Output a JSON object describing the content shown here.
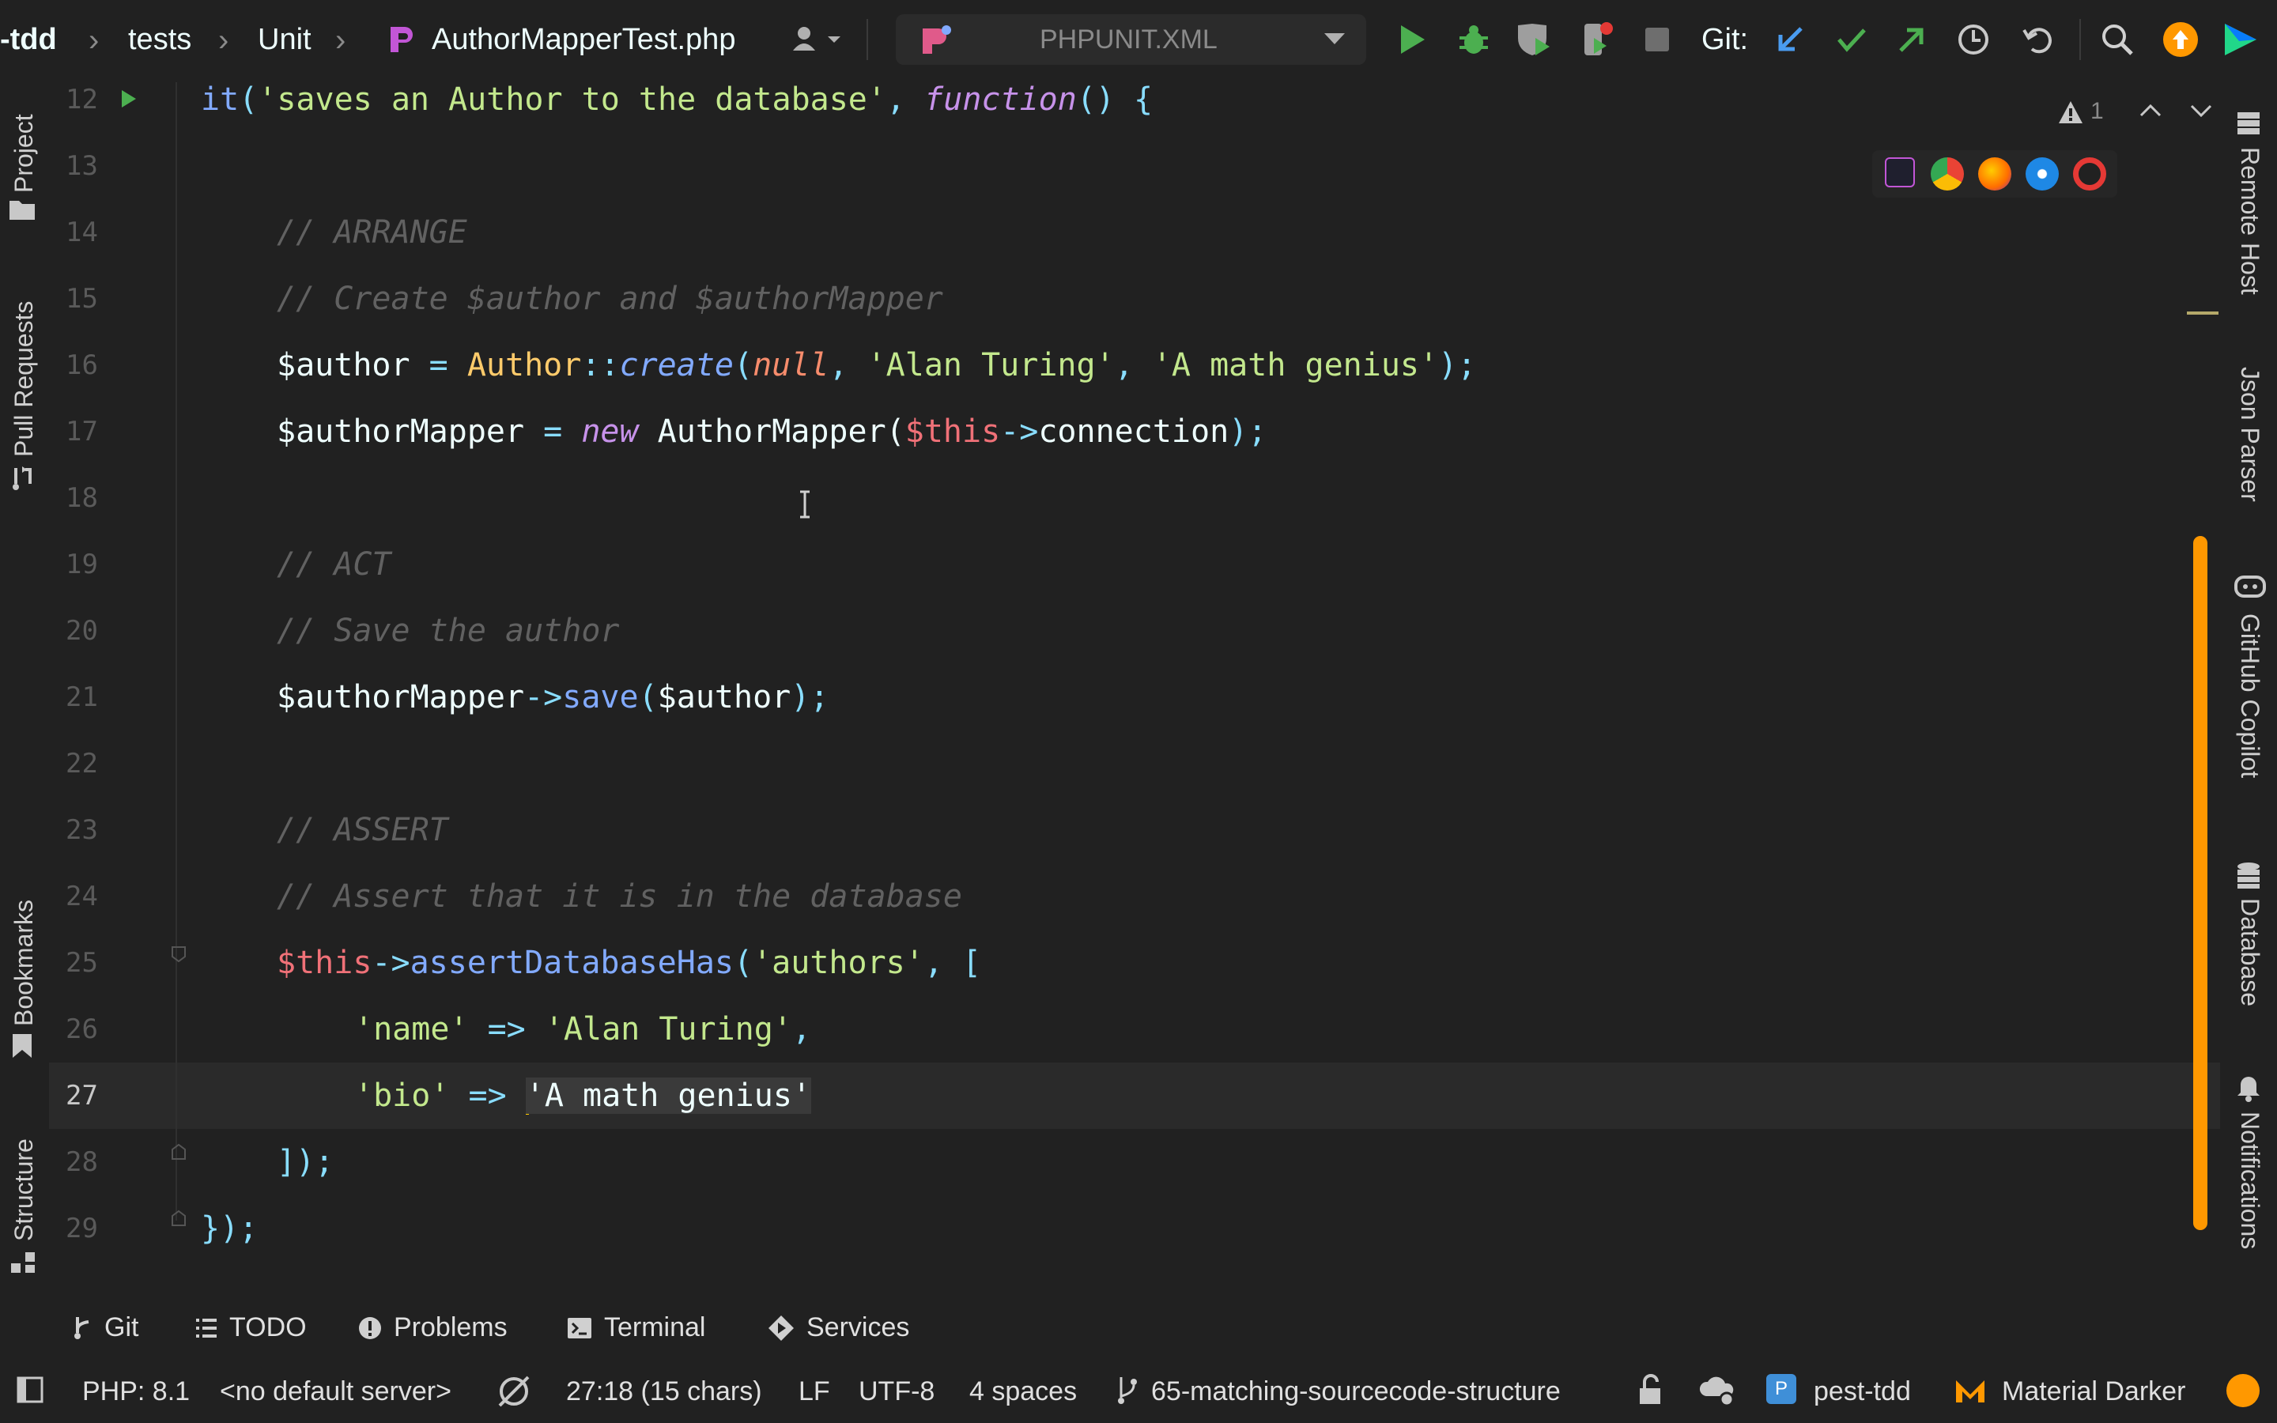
{
  "breadcrumb": {
    "project": "-tdd",
    "folder1": "tests",
    "folder2": "Unit",
    "file": "AuthorMapperTest.php"
  },
  "run_config": {
    "label": "PHPUNIT.XML"
  },
  "git_label": "Git:",
  "inspection": {
    "warning_count": "1"
  },
  "left_tools": [
    "Project",
    "Pull Requests",
    "Bookmarks",
    "Structure"
  ],
  "right_tools": [
    "Remote Host",
    "Json Parser",
    "GitHub Copilot",
    "Database",
    "Notifications"
  ],
  "editor": {
    "current_line": 27,
    "lines": [
      {
        "n": "12"
      },
      {
        "n": "13"
      },
      {
        "n": "14"
      },
      {
        "n": "15"
      },
      {
        "n": "16"
      },
      {
        "n": "17"
      },
      {
        "n": "18"
      },
      {
        "n": "19"
      },
      {
        "n": "20"
      },
      {
        "n": "21"
      },
      {
        "n": "22"
      },
      {
        "n": "23"
      },
      {
        "n": "24"
      },
      {
        "n": "25"
      },
      {
        "n": "26"
      },
      {
        "n": "27"
      },
      {
        "n": "28"
      },
      {
        "n": "29"
      }
    ],
    "tokens": {
      "l12": [
        "it",
        "(",
        "'saves an Author to the database'",
        ", ",
        "function",
        "() {"
      ],
      "l14": "// ARRANGE",
      "l15": "// Create $author and $authorMapper",
      "l16": [
        "$author",
        " = ",
        "Author",
        "::",
        "create",
        "(",
        "null",
        ", ",
        "'Alan Turing'",
        ", ",
        "'A math genius'",
        ");"
      ],
      "l17": [
        "$authorMapper",
        " = ",
        "new",
        " AuthorMapper(",
        "$this",
        "->",
        "connection",
        ");"
      ],
      "l19": "// ACT",
      "l20": "// Save the author",
      "l21": [
        "$authorMapper",
        "->",
        "save",
        "(",
        "$author",
        ");"
      ],
      "l23": "// ASSERT",
      "l24": "// Assert that it is in the database",
      "l25": [
        "$this",
        "->",
        "assertDatabaseHas",
        "(",
        "'authors'",
        ", ["
      ],
      "l26": [
        "'name'",
        " => ",
        "'Alan Turing'",
        ","
      ],
      "l27": [
        "'bio'",
        " => ",
        "'A math genius'"
      ],
      "l28": "]);",
      "l29": "});"
    }
  },
  "bottom_tabs": [
    "Git",
    "TODO",
    "Problems",
    "Terminal",
    "Services"
  ],
  "status": {
    "php": "PHP: 8.1",
    "server": "<no default server>",
    "position": "27:18 (15 chars)",
    "line_sep": "LF",
    "encoding": "UTF-8",
    "indent": "4 spaces",
    "branch": "65-matching-sourcecode-structure",
    "project": "pest-tdd",
    "theme": "Material Darker"
  },
  "colors": {
    "background": "#212121",
    "accent_orange": "#ff9800",
    "run_green": "#4caf50"
  }
}
